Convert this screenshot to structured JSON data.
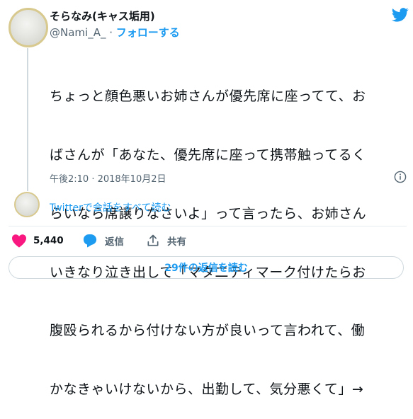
{
  "user": {
    "display_name": "そらなみ(キャス垢用)",
    "handle": "@Nami_A_",
    "separator": "·",
    "follow_label": "フォローする"
  },
  "tweet": {
    "lines": [
      "ちょっと顔色悪いお姉さんが優先席に座ってて、お",
      "ばさんが「あなた、優先席に座って携帯触ってるく",
      "らいなら席譲りなさいよ」って言ったら、お姉さん",
      "いきなり泣き出して「マタ二ティマーク付けたらお",
      "腹殴られるから付けない方が良いって言われて、働",
      "かなきゃいけないから、出勤して、気分悪くて」→"
    ],
    "timestamp": "午後2:10 · 2018年10月2日"
  },
  "thread": {
    "read_all_label": "Twitterで会話をすべて読む"
  },
  "actions": {
    "like_count": "5,440",
    "reply_label": "返信",
    "share_label": "共有"
  },
  "replies_button": {
    "label": "29件の返信を読む"
  },
  "icons": {
    "logo": "twitter-bird-icon",
    "info": "info-icon",
    "like": "heart-icon",
    "reply": "speech-bubble-icon",
    "share": "share-icon"
  },
  "colors": {
    "accent": "#1d9bf0",
    "like": "#f91880",
    "text": "#0f1419",
    "muted": "#536471"
  }
}
